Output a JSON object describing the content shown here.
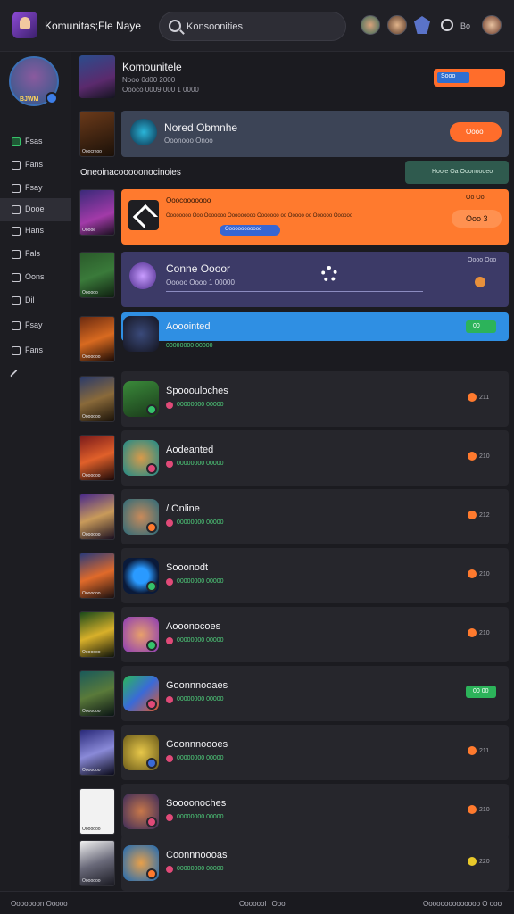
{
  "topbar": {
    "app_title": "Komunitas;Fle Naye",
    "search_text": "Konsoonities",
    "user_label": "Bo"
  },
  "sidebar": {
    "profile_name": "BJWM",
    "items": [
      {
        "label": "Fsas",
        "icon": "green-square-icon"
      },
      {
        "label": "Fans",
        "icon": "square-icon"
      },
      {
        "label": "Fsay",
        "icon": "square-icon"
      },
      {
        "label": "Dooe",
        "icon": "square-icon"
      },
      {
        "label": "Hans",
        "icon": "square-icon"
      },
      {
        "label": "Fals",
        "icon": "square-icon"
      },
      {
        "label": "Oons",
        "icon": "square-icon"
      },
      {
        "label": "Dil",
        "icon": "square-icon"
      },
      {
        "label": "Fsay",
        "icon": "square-icon"
      },
      {
        "label": "Fans",
        "icon": "square-icon"
      },
      {
        "label": "",
        "icon": "pin-icon"
      }
    ]
  },
  "header": {
    "title": "Komounitele",
    "subtitle": "Nooo 0d00 2000",
    "subtitle2": "Oooco 0009 000 1 0000",
    "button_label": "Sooo"
  },
  "featured": {
    "thumb_caption": "Ooocrnoo",
    "title": "Nored Obmnhe",
    "subtitle": "Ooonooo Onoo",
    "button_label": "Oooo"
  },
  "section": {
    "title": "Oneoinacooooonocinoies",
    "tag_label": "Hoole Oa Ooonoooeo"
  },
  "orange_card": {
    "thumb_caption": "Ooooe",
    "title": "Ooocooooooo",
    "description": "Oooooooo Ooo Ooooooo Ooooooooo Ooooooo oo Ooooo oo Oooooo Oooooo",
    "chip_label": "Oooooooooooo",
    "corner_label": "Oo Oo",
    "button_label": "Ooo 3"
  },
  "purple_card": {
    "thumb_caption": "Oooooo",
    "title": "Conne Oooor",
    "subtitle": "Ooooo Oooo 1 00000",
    "corner_label": "Oooo Ooo"
  },
  "rows": [
    {
      "title": "Aooointed",
      "sub": "00000000 00000",
      "badge": "00",
      "thumb_caption": "Ooooooo",
      "highlight": true
    },
    {
      "title": "Spooouloches",
      "sub": "00000000 00000",
      "badge": "211",
      "thumb_caption": "Ooooooo"
    },
    {
      "title": "Aodeanted",
      "sub": "00000000 00000",
      "badge": "210",
      "thumb_caption": "Ooooooo"
    },
    {
      "title": "/ Online",
      "sub": "00000000 00000",
      "badge": "212",
      "thumb_caption": "Ooooooo"
    },
    {
      "title": "Sooonodt",
      "sub": "00000000 00000",
      "badge": "210",
      "thumb_caption": "Ooooooo"
    },
    {
      "title": "Aooonocoes",
      "sub": "00000000 00000",
      "badge": "210",
      "thumb_caption": "Ooooooo"
    },
    {
      "title": "Goonnnooaes",
      "sub": "00000000 00000",
      "badge": "00 00",
      "thumb_caption": "Ooooooo",
      "pill": true
    },
    {
      "title": "Goonnnoooes",
      "sub": "00000000 00000",
      "badge": "211",
      "thumb_caption": "Ooooooo"
    },
    {
      "title": "Soooonoches",
      "sub": "00000000 00000",
      "badge": "210",
      "thumb_caption": "Ooooooo"
    },
    {
      "title": "Coonnnoooas",
      "sub": "00000000 00000",
      "badge": "220",
      "thumb_caption": "Ooooooo"
    }
  ],
  "footer": {
    "left": "Ooooooon Ooooo",
    "mid": "Ooooool l Ooo",
    "right": "Oooooooooooooo O ooo"
  },
  "colors": {
    "accent_orange": "#ff7a2e",
    "accent_blue": "#2f8fe3",
    "accent_green": "#2cb35a",
    "card_purple": "#3c3a67",
    "card_slate": "#3c4456"
  }
}
